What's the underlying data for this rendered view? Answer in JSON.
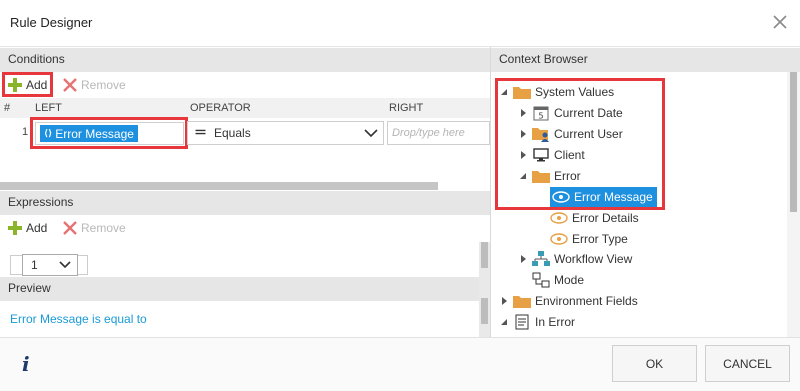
{
  "dialog": {
    "title": "Rule Designer"
  },
  "conditions": {
    "title": "Conditions",
    "add_label": "Add",
    "remove_label": "Remove",
    "columns": {
      "num": "#",
      "left": "LEFT",
      "operator": "OPERATOR",
      "right": "RIGHT"
    },
    "row": {
      "num": "1",
      "left_token": "Error Message",
      "operator": "Equals",
      "right_placeholder": "Drop/type here"
    }
  },
  "expressions": {
    "title": "Expressions",
    "add_label": "Add",
    "remove_label": "Remove",
    "page_value": "1"
  },
  "preview": {
    "title": "Preview",
    "text": "Error Message is equal to"
  },
  "context_browser": {
    "title": "Context Browser",
    "items": {
      "system_values": "System Values",
      "current_date": "Current Date",
      "current_user": "Current User",
      "client": "Client",
      "error": "Error",
      "error_message": "Error Message",
      "error_details": "Error Details",
      "error_type": "Error Type",
      "workflow_view": "Workflow View",
      "mode": "Mode",
      "environment_fields": "Environment Fields",
      "in_error": "In Error"
    },
    "current_date_badge": "5"
  },
  "footer": {
    "ok_label": "OK",
    "cancel_label": "CANCEL",
    "info_glyph": "i"
  },
  "colors": {
    "accent_blue": "#1e90e0",
    "highlight_red": "#e8363d",
    "add_green": "#8ab528",
    "remove_red": "#e57373",
    "folder_orange": "#e8a045"
  }
}
